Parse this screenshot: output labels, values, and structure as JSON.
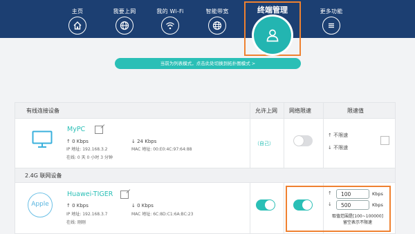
{
  "nav": {
    "items": [
      {
        "label": "主页",
        "icon": "home-icon"
      },
      {
        "label": "我要上网",
        "icon": "globe-icon"
      },
      {
        "label": "我的 Wi-Fi",
        "icon": "wifi-icon"
      },
      {
        "label": "智能带宽",
        "icon": "bandwidth-globe-icon"
      },
      {
        "label": "终端管理",
        "icon": "user-icon"
      },
      {
        "label": "更多功能",
        "icon": "menu-icon"
      }
    ]
  },
  "mode_bar": {
    "text": "当前为列表模式，点击此处切换到拓扑图模式 >"
  },
  "table": {
    "headers": {
      "wired": "有线连接设备",
      "allow": "允许上网",
      "limit": "网络限速",
      "limit_value": "限速值"
    },
    "wired_devices": [
      {
        "name": "MyPC",
        "up": "0 Kbps",
        "down": "24 Kbps",
        "ip": "IP 地址: 192.168.3.2",
        "mac": "MAC 地址: 00:E0:4C:97:64:88",
        "online": "在线: 0 天 0 小时 3 分钟",
        "allow_text": "（自己）",
        "limit_on": false,
        "up_limit": "不限速",
        "down_limit": "不限速"
      }
    ],
    "section_24g": "2.4G 联网设备",
    "wifi_devices": [
      {
        "name": "Huawei-TIGER",
        "avatar": "Apple",
        "up": "0 Kbps",
        "down": "0 Kbps",
        "ip": "IP 地址: 192.168.3.7",
        "mac": "MAC 地址: 6C:8D:C1:6A:BC:23",
        "online": "在线: 刚刚",
        "allow_on": true,
        "limit_on": true,
        "up_value": "100",
        "down_value": "500",
        "unit": "Kbps",
        "hint_line1": "取值范围是[100~100000]",
        "hint_line2": "留空表示不限速"
      }
    ]
  },
  "colors": {
    "nav_bg": "#1c3f72",
    "accent": "#2abfb6",
    "highlight": "#ef8130"
  }
}
